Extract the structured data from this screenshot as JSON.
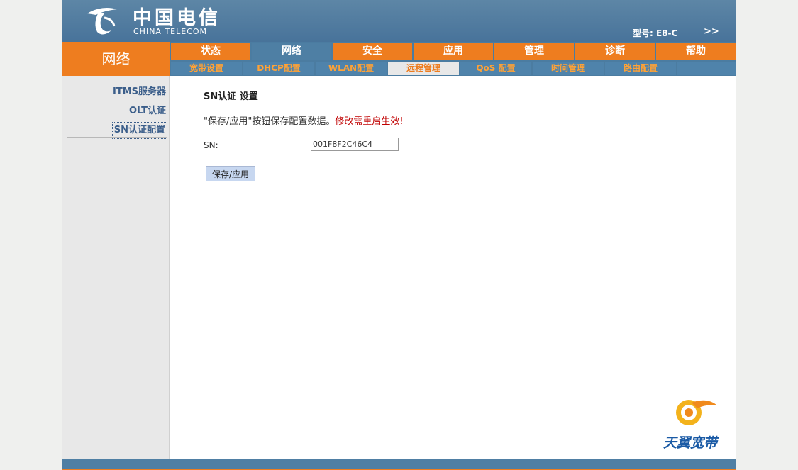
{
  "header": {
    "logo_cn": "中国电信",
    "logo_en": "CHINA TELECOM",
    "model_label": "型号: E8-C",
    "more_label": ">>"
  },
  "section_title": "网络",
  "main_tabs": [
    "状态",
    "网络",
    "安全",
    "应用",
    "管理",
    "诊断",
    "帮助"
  ],
  "sub_tabs": [
    "宽带设置",
    "DHCP配置",
    "WLAN配置",
    "远程管理",
    "QoS 配置",
    "时间管理",
    "路由配置"
  ],
  "sidebar": {
    "items": [
      "ITMS服务器",
      "OLT认证",
      "SN认证配置"
    ]
  },
  "content": {
    "title": "SN认证 设置",
    "notice_prefix": "\"保存/应用\"按钮保存配置数据。",
    "notice_warning": "修改需重启生效!",
    "sn_label": "SN:",
    "sn_value": "001F8F2C46C4",
    "save_label": "保存/应用"
  },
  "brand": {
    "text": "天翼宽带"
  },
  "colors": {
    "accent_orange": "#ee7d1f",
    "header_blue": "#4b7ca1",
    "warning_red": "#c00000"
  }
}
